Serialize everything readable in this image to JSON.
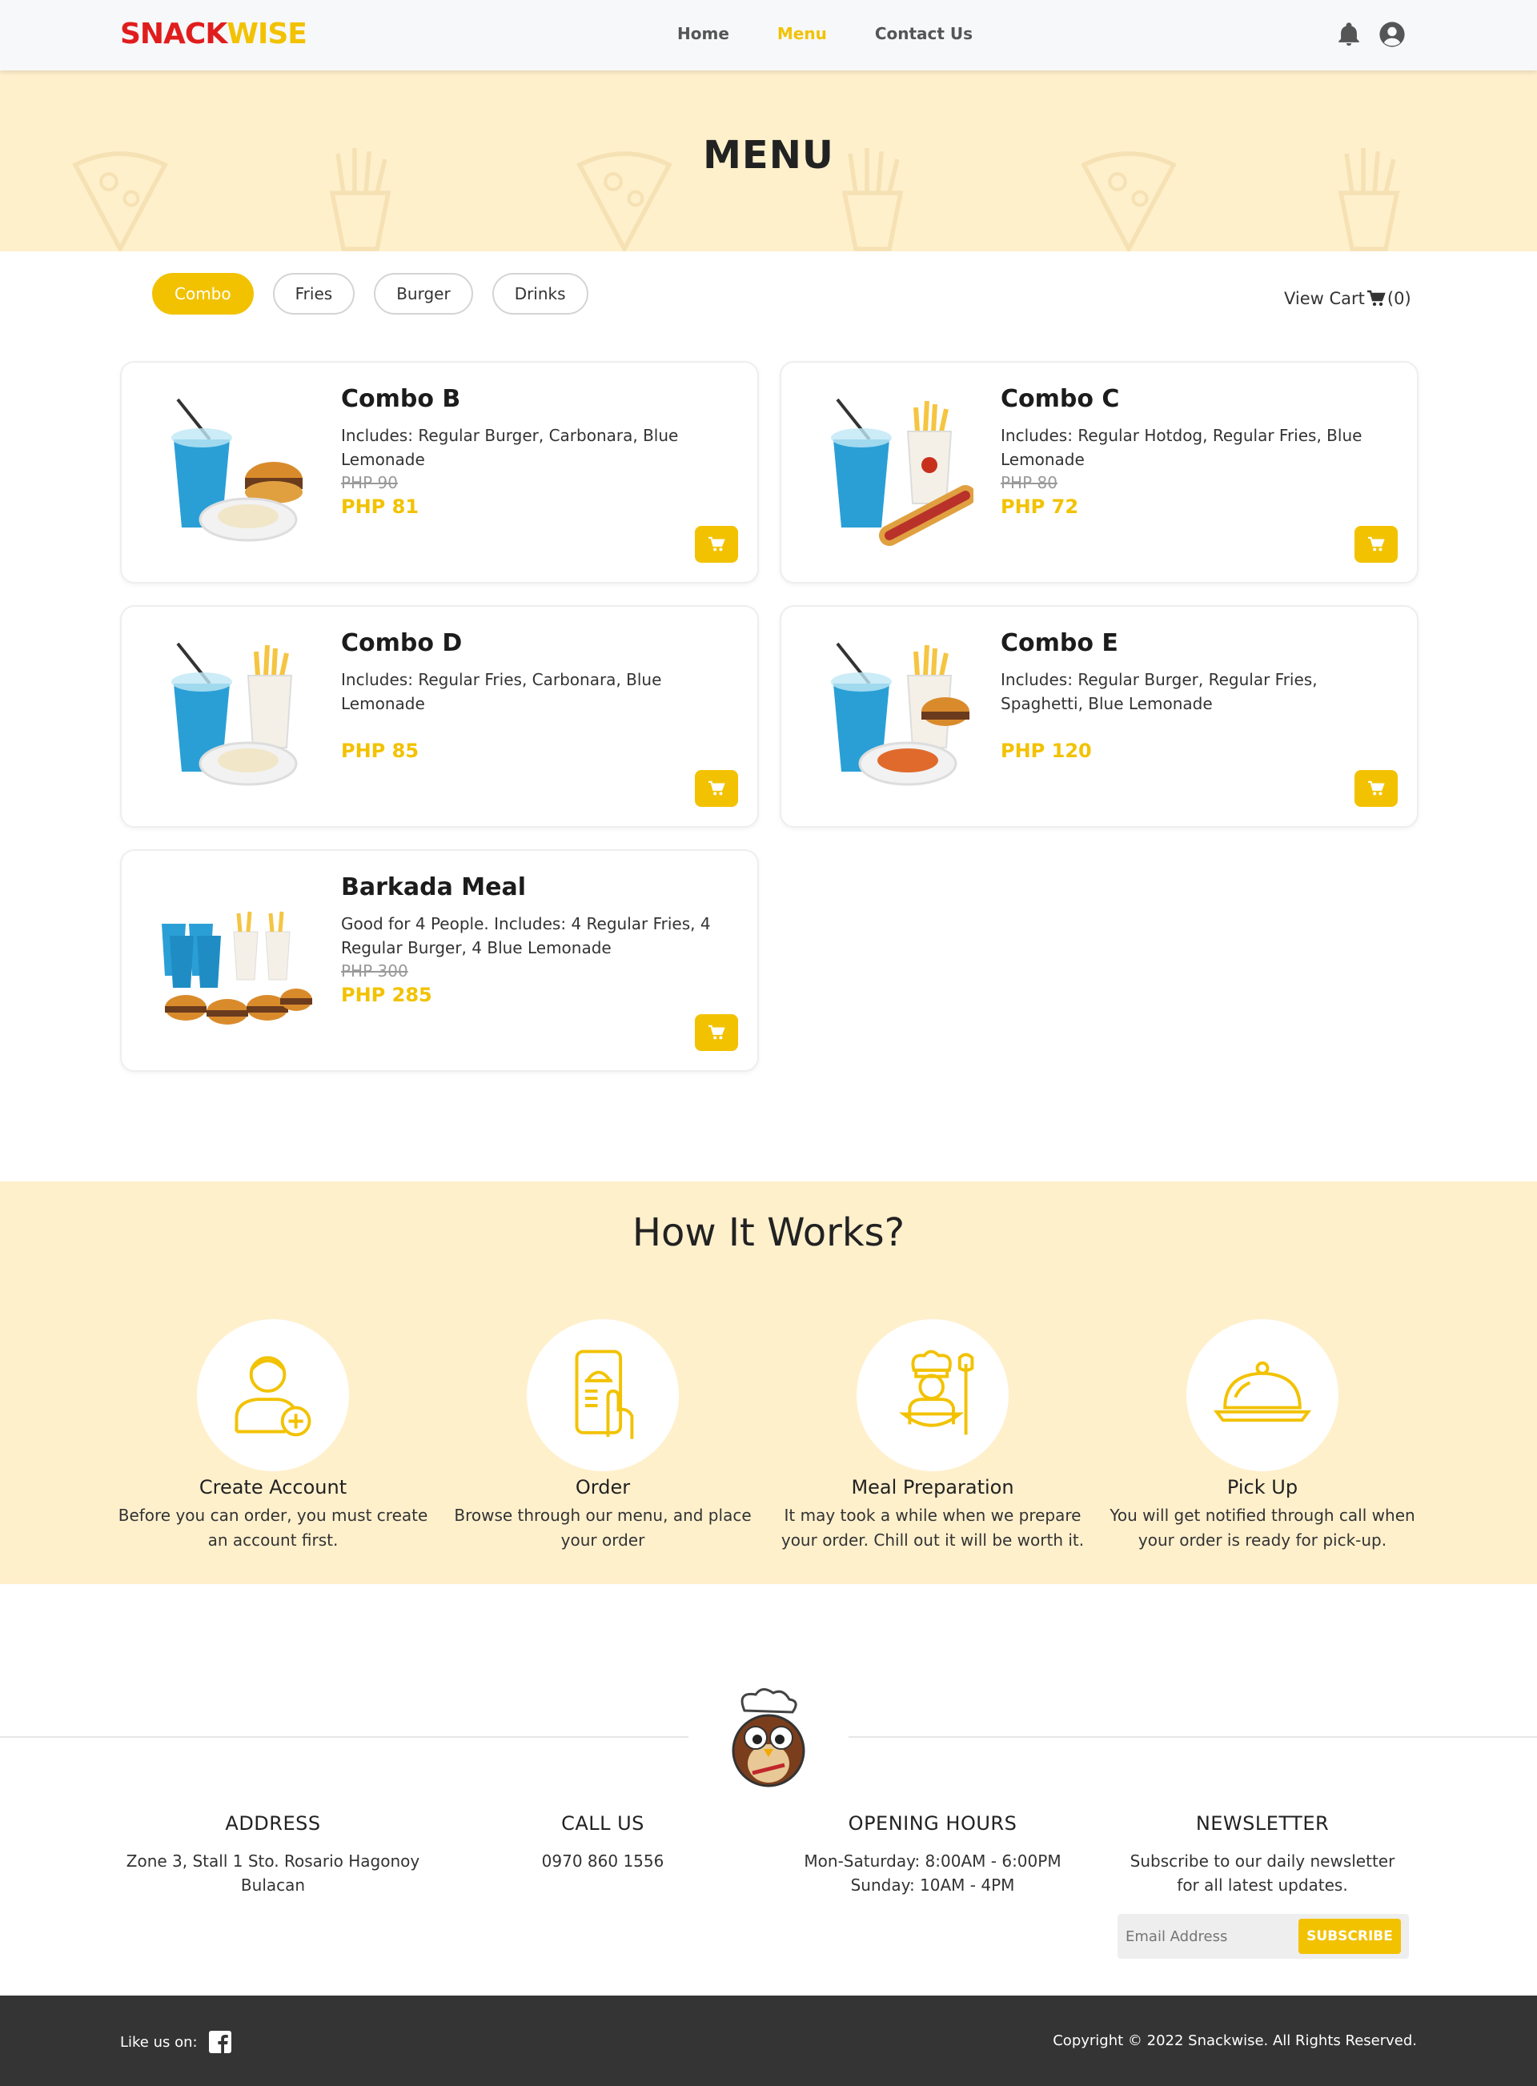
{
  "brand": {
    "part1": "SNACK",
    "part2": "WISE",
    "red": "#e01d1d",
    "yellow": "#f2c200"
  },
  "nav": {
    "links": [
      {
        "label": "Home",
        "active": false
      },
      {
        "label": "Menu",
        "active": true
      },
      {
        "label": "Contact Us",
        "active": false
      }
    ],
    "icons": [
      "bell-icon",
      "user-circle-icon"
    ]
  },
  "hero": {
    "title": "MENU"
  },
  "filters": [
    {
      "label": "Combo",
      "active": true
    },
    {
      "label": "Fries",
      "active": false
    },
    {
      "label": "Burger",
      "active": false
    },
    {
      "label": "Drinks",
      "active": false
    }
  ],
  "cart": {
    "label": "View Cart",
    "count": "(0)"
  },
  "products": [
    {
      "name": "Combo B",
      "desc": "Includes: Regular Burger, Carbonara, Blue Lemonade",
      "old_price": "PHP 90",
      "price": "PHP 81"
    },
    {
      "name": "Combo C",
      "desc": "Includes: Regular Hotdog, Regular Fries, Blue Lemonade",
      "old_price": "PHP 80",
      "price": "PHP 72"
    },
    {
      "name": "Combo D",
      "desc": "Includes: Regular Fries, Carbonara, Blue Lemonade",
      "old_price": "",
      "price": "PHP 85"
    },
    {
      "name": "Combo E",
      "desc": "Includes: Regular Burger, Regular Fries, Spaghetti, Blue Lemonade",
      "old_price": "",
      "price": "PHP 120"
    },
    {
      "name": "Barkada Meal",
      "desc": "Good for 4 People. Includes: 4 Regular Fries, 4 Regular Burger, 4 Blue Lemonade",
      "old_price": "PHP 300",
      "price": "PHP 285"
    }
  ],
  "how": {
    "title": "How It Works?",
    "steps": [
      {
        "title": "Create Account",
        "desc": "Before you can order, you must create an account first."
      },
      {
        "title": "Order",
        "desc": "Browse through our menu, and place your order"
      },
      {
        "title": "Meal Preparation",
        "desc": "It may took a while when we prepare your order. Chill out it will be worth it."
      },
      {
        "title": "Pick Up",
        "desc": "You will get notified through call when your order is ready for pick-up."
      }
    ]
  },
  "footer": {
    "address": {
      "heading": "ADDRESS",
      "text": "Zone 3, Stall 1 Sto. Rosario Hagonoy Bulacan"
    },
    "call": {
      "heading": "CALL US",
      "text": "0970 860 1556"
    },
    "hours": {
      "heading": "OPENING HOURS",
      "line1": "Mon-Saturday: 8:00AM - 6:00PM",
      "line2": "Sunday: 10AM - 4PM"
    },
    "newsletter": {
      "heading": "NEWSLETTER",
      "text": "Subscribe to our daily newsletter for all latest updates.",
      "placeholder": "Email Address",
      "button": "SUBSCRIBE"
    },
    "like": "Like us on:",
    "copyright": "Copyright © 2022 Snackwise. All Rights Reserved."
  }
}
